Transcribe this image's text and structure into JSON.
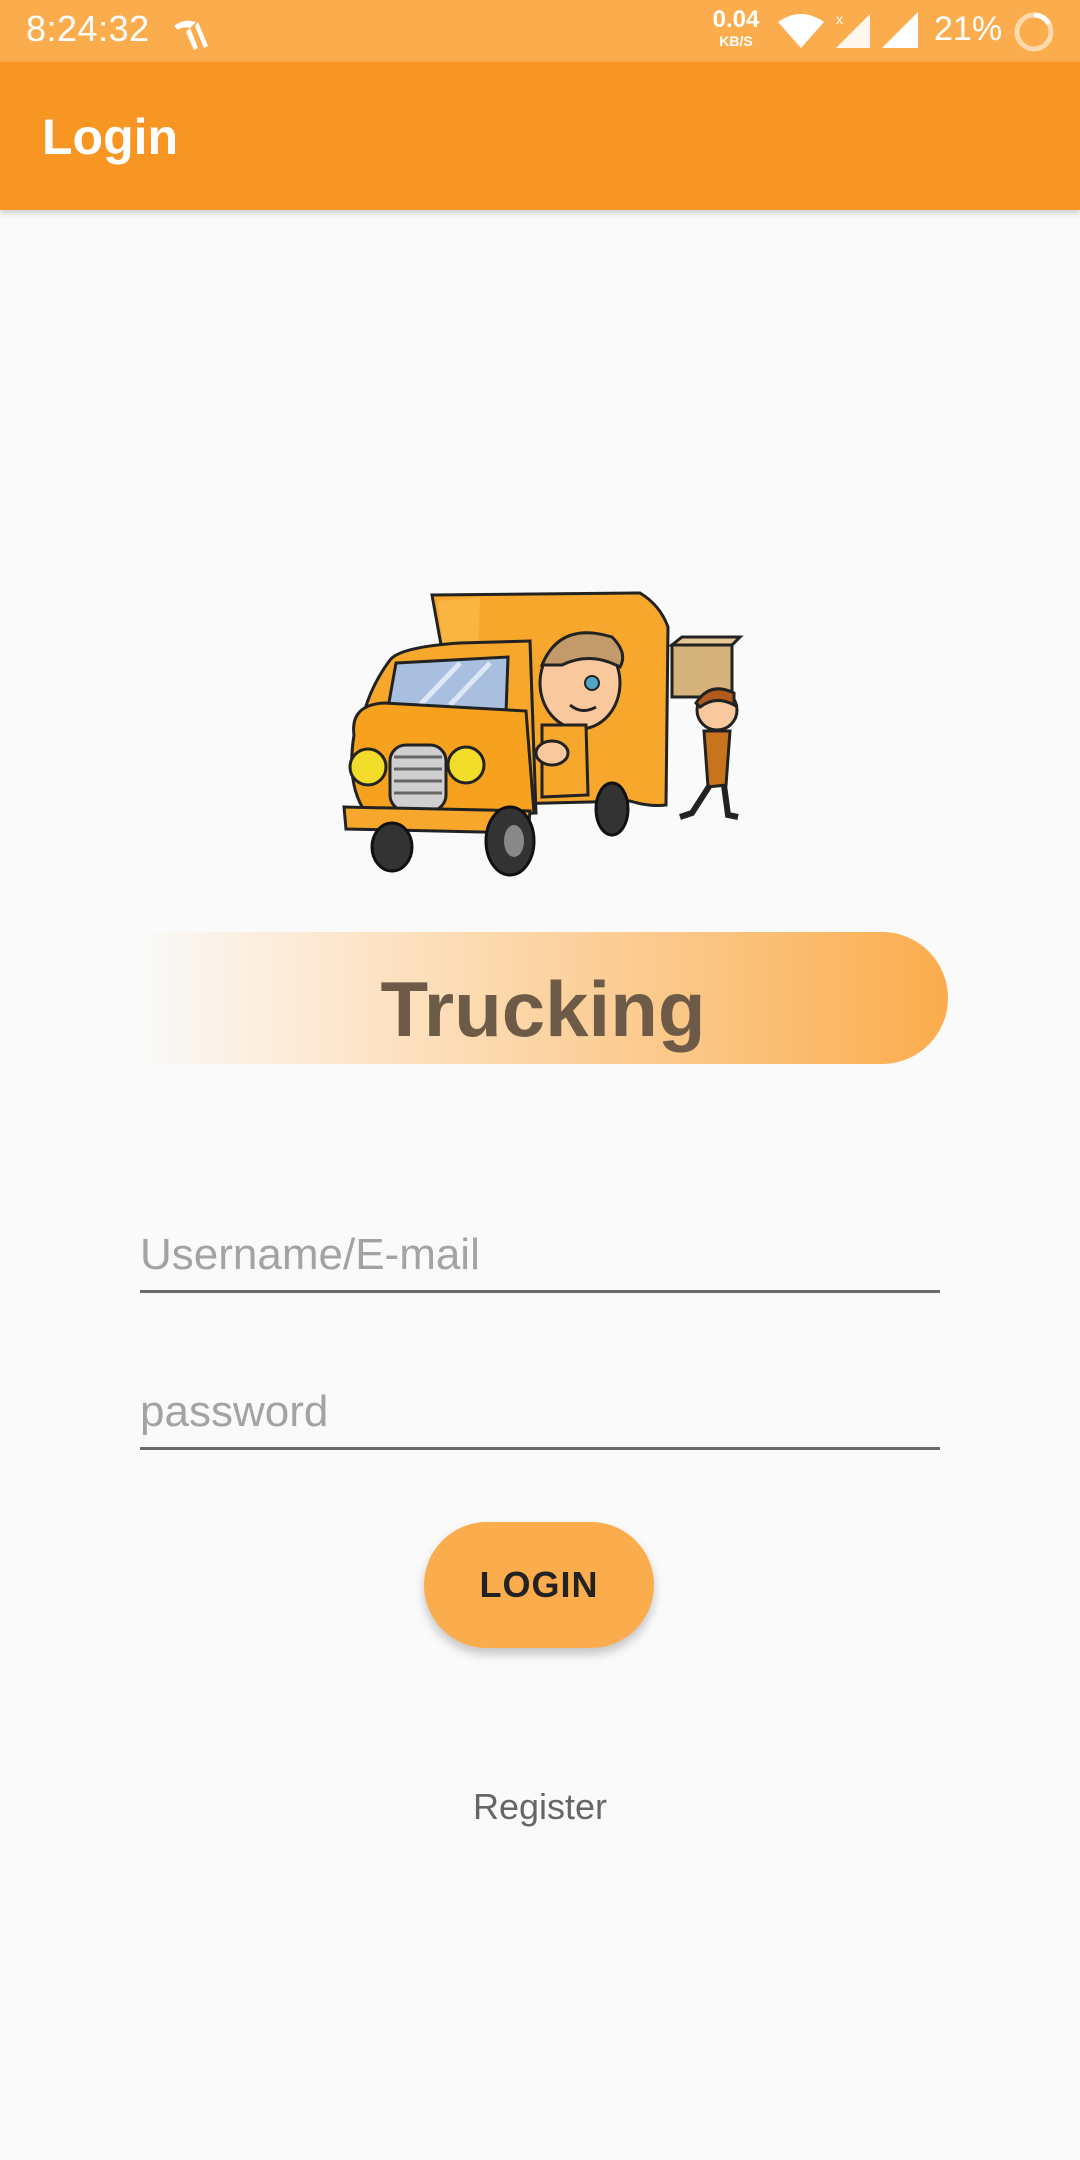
{
  "status_bar": {
    "time": "8:24:32",
    "net_speed_value": "0.04",
    "net_speed_unit": "KB/S",
    "battery_percent": "21%",
    "icons": [
      "carrier-icon",
      "wifi-icon",
      "signal-icon",
      "signal-icon",
      "battery-icon"
    ]
  },
  "app_bar": {
    "title": "Login"
  },
  "brand": {
    "title": "Trucking"
  },
  "form": {
    "username_placeholder": "Username/E-mail",
    "password_placeholder": "password",
    "login_label": "LOGIN",
    "register_label": "Register"
  },
  "colors": {
    "status_bar": "#fbac4c",
    "app_bar": "#f79622",
    "accent": "#fbac4c",
    "brand_text": "#6d5b48"
  }
}
